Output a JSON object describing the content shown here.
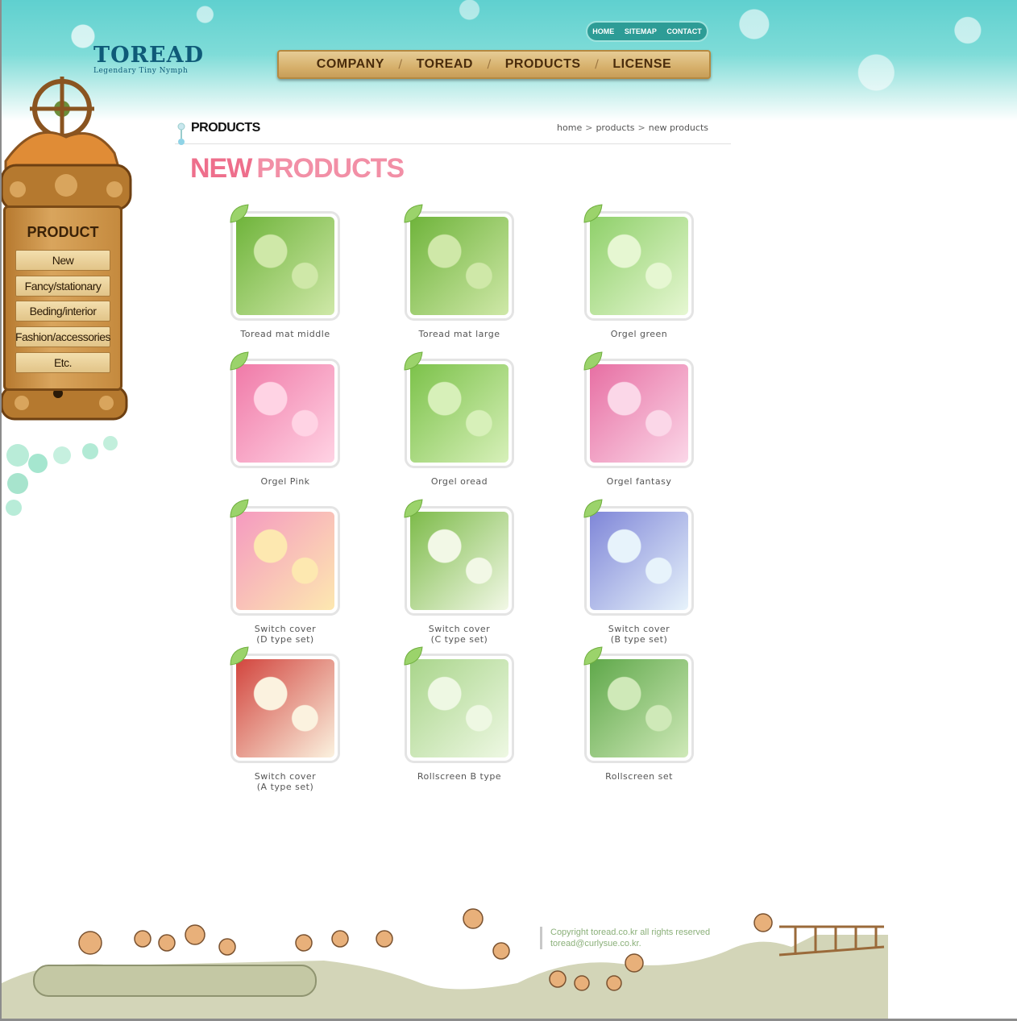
{
  "brand": {
    "name": "TOREAD",
    "tagline": "Legendary Tiny Nymph"
  },
  "util_nav": [
    "HOME",
    "SITEMAP",
    "CONTACT"
  ],
  "main_nav": [
    "COMPANY",
    "TOREAD",
    "PRODUCTS",
    "LICENSE"
  ],
  "sidebar": {
    "title": "PRODUCT",
    "items": [
      "New",
      "Fancy/stationary",
      "Beding/interior",
      "Fashion/accessories",
      "Etc."
    ]
  },
  "section": {
    "title": "PRODUCTS",
    "breadcrumb": [
      "home",
      "products",
      "new products"
    ]
  },
  "heading": {
    "word1": "NEW",
    "word2": "PRODUCTS"
  },
  "products": [
    {
      "line1": "Toread mat middle",
      "line2": "",
      "colors": [
        "#6fb43b",
        "#cfe8a8"
      ]
    },
    {
      "line1": "Toread mat large",
      "line2": "",
      "colors": [
        "#6fb43b",
        "#cfe8a8"
      ]
    },
    {
      "line1": "Orgel green",
      "line2": "",
      "colors": [
        "#8fd06a",
        "#e6f7d2"
      ]
    },
    {
      "line1": "Orgel Pink",
      "line2": "",
      "colors": [
        "#f07aa8",
        "#ffd3e4"
      ]
    },
    {
      "line1": "Orgel oread",
      "line2": "",
      "colors": [
        "#7cc24a",
        "#d7f0b9"
      ]
    },
    {
      "line1": "Orgel fantasy",
      "line2": "",
      "colors": [
        "#e76fa3",
        "#fbd7e8"
      ]
    },
    {
      "line1": "Switch cover",
      "line2": "(D type set)",
      "colors": [
        "#f59ac0",
        "#fde8b0"
      ]
    },
    {
      "line1": "Switch cover",
      "line2": "(C type set)",
      "colors": [
        "#7dbb4a",
        "#f2f8e6"
      ]
    },
    {
      "line1": "Switch cover",
      "line2": "(B type set)",
      "colors": [
        "#7f86d8",
        "#e7f3fb"
      ]
    },
    {
      "line1": "Switch cover",
      "line2": "(A type set)",
      "colors": [
        "#d2453e",
        "#fbf2df"
      ]
    },
    {
      "line1": "Rollscreen B type",
      "line2": "",
      "colors": [
        "#a9d58b",
        "#eef8e3"
      ]
    },
    {
      "line1": "Rollscreen set",
      "line2": "",
      "colors": [
        "#5fa84a",
        "#cfe9b8"
      ]
    }
  ],
  "footer": {
    "copyright": "Copyright toread.co.kr all rights reserved",
    "email": "toread@curlysue.co.kr."
  },
  "colors": {
    "header": "#6fd4d2",
    "heading_pink": "#ee6f8c",
    "wood": "#c58a3e"
  }
}
